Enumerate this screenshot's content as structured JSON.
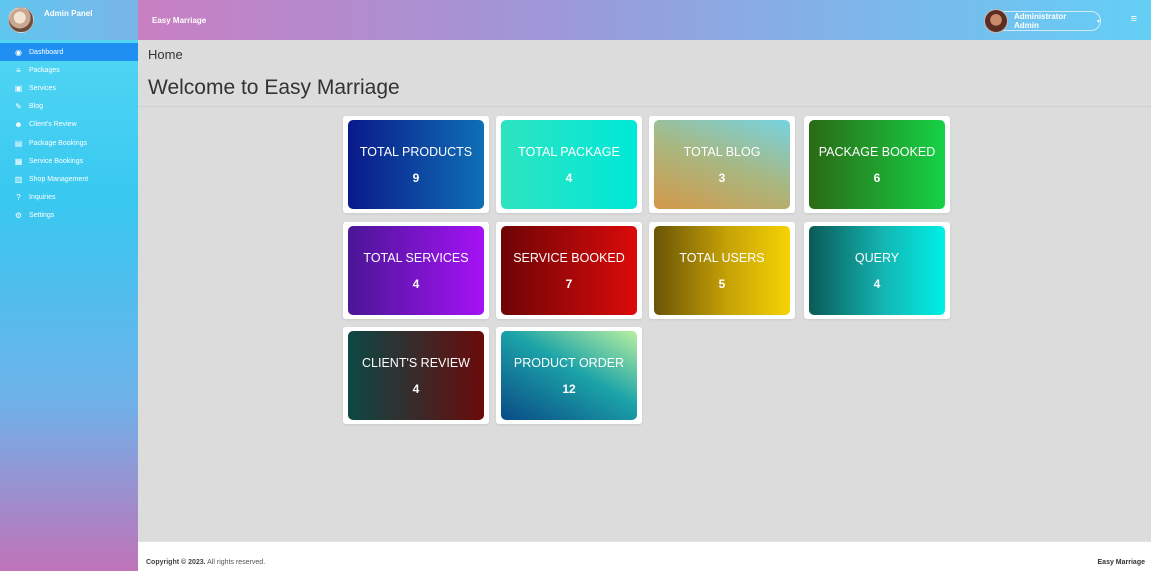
{
  "sidebar": {
    "brand_title": "Admin Panel",
    "items": [
      {
        "label": "Dashboard",
        "icon": "dashboard-icon",
        "glyph": "◉"
      },
      {
        "label": "Packages",
        "icon": "database-icon",
        "glyph": "≡"
      },
      {
        "label": "Services",
        "icon": "gift-icon",
        "glyph": "▣"
      },
      {
        "label": "Blog",
        "icon": "blog-icon",
        "glyph": "✎"
      },
      {
        "label": "Client's Review",
        "icon": "users-icon",
        "glyph": "☻"
      },
      {
        "label": "Package Bookings",
        "icon": "clipboard-icon",
        "glyph": "▤"
      },
      {
        "label": "Service Bookings",
        "icon": "calendar-icon",
        "glyph": "▦"
      },
      {
        "label": "Shop Management",
        "icon": "shop-icon",
        "glyph": "▥"
      },
      {
        "label": "Inquiries",
        "icon": "question-icon",
        "glyph": "?"
      },
      {
        "label": "Settings",
        "icon": "settings-icon",
        "glyph": "⚙"
      }
    ]
  },
  "topbar": {
    "title": "Easy Marriage",
    "user_name": "Administrator Admin",
    "caret": "▾",
    "menu_glyph": "≡"
  },
  "main": {
    "breadcrumb": "Home",
    "title": "Welcome to Easy Marriage",
    "cards": [
      {
        "label": "TOTAL PRODUCTS",
        "value": "9",
        "gradient": "linear-gradient(90deg, #0a1a8a 0%, #0f6fb5 100%)"
      },
      {
        "label": "TOTAL PACKAGE",
        "value": "4",
        "gradient": "linear-gradient(90deg, #2ee3c0 0%, #00e8d8 100%)"
      },
      {
        "label": "TOTAL BLOG",
        "value": "3",
        "gradient": "linear-gradient(20deg, #d49848 0%, #a9b780 50%, #76d3e2 100%)"
      },
      {
        "label": "PACKAGE BOOKED",
        "value": "6",
        "gradient": "linear-gradient(90deg, #2a6a14 0%, #16d246 100%)"
      },
      {
        "label": "TOTAL SERVICES",
        "value": "4",
        "gradient": "linear-gradient(90deg, #4a1696 0%, #a512f5 100%)"
      },
      {
        "label": "SERVICE BOOKED",
        "value": "7",
        "gradient": "linear-gradient(90deg, #6e0406 0%, #dc0a0a 100%)"
      },
      {
        "label": "TOTAL USERS",
        "value": "5",
        "gradient": "linear-gradient(90deg, #6a5406 0%, #c7a306 55%, #f6d304 100%)"
      },
      {
        "label": "QUERY",
        "value": "4",
        "gradient": "linear-gradient(90deg, #0b5a56 0%, #14b6b3 55%, #00f0e6 100%)"
      },
      {
        "label": "CLIENT'S REVIEW",
        "value": "4",
        "gradient": "linear-gradient(90deg, #0d4844 0%, #3a2a2a 50%, #6a0a0a 100%)"
      },
      {
        "label": "PRODUCT ORDER",
        "value": "12",
        "gradient": "linear-gradient(210deg, #b9f0a0 0%, #1ba3a8 45%, #0a4a86 100%)"
      }
    ]
  },
  "footer": {
    "copyright_bold": "Copyright © 2023.",
    "copyright_rest": " All rights reserved.",
    "brand": "Easy Marriage"
  }
}
